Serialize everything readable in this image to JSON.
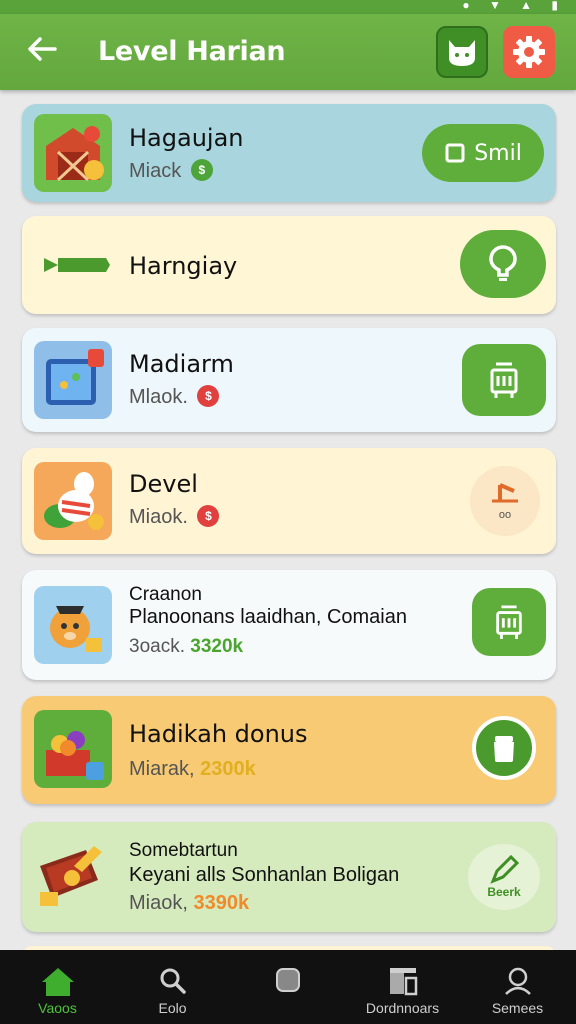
{
  "header": {
    "title": "Level Harian",
    "back_icon": "arrow-left-icon",
    "cat_icon": "cat-icon",
    "gear_icon": "gear-icon",
    "accent": "#63a83d"
  },
  "cards": [
    {
      "title": "Hagaujan",
      "subtitle": "Miack",
      "badge_color": "green",
      "action_label": "Smil",
      "bg": "#a9d6de"
    },
    {
      "title": "Harngiay",
      "bg": "#fff6d6"
    },
    {
      "title": "Madiarm",
      "subtitle": "Mlaok.",
      "badge_color": "red",
      "bg": "#eef7fb"
    },
    {
      "title": "Devel",
      "subtitle": "Miaok.",
      "badge_color": "red",
      "action_label": "oo",
      "bg": "#fff4d4"
    },
    {
      "line1": "Craanon",
      "line2": "Planoonans laaidhan, Comaian",
      "sub_prefix": "3oack.",
      "amount": "3320k",
      "bg": "#f6fafb"
    },
    {
      "title": "Hadikah donus",
      "sub_prefix": "Miarak,",
      "amount": "2300k",
      "bg": "#f8ca74"
    },
    {
      "line1": "Somebtartun",
      "line2": "Keyani alls Sonhanlan Boligan",
      "sub_prefix": "Miaok,",
      "amount": "3390k",
      "action_label": "Beerk",
      "bg": "#d6ebbd"
    }
  ],
  "nav": [
    {
      "label": "Vaoos",
      "icon": "home-icon",
      "active": true
    },
    {
      "label": "Eolo",
      "icon": "search-icon"
    },
    {
      "label": "",
      "icon": "square-icon"
    },
    {
      "label": "Dordnnoars",
      "icon": "store-icon"
    },
    {
      "label": "Semees",
      "icon": "profile-icon"
    }
  ]
}
